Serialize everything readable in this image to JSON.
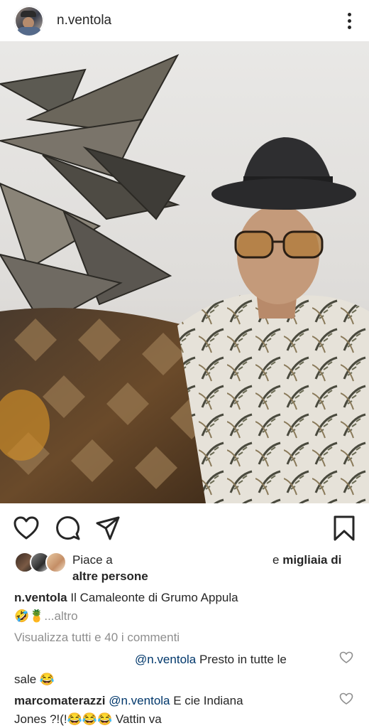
{
  "post": {
    "username": "n.ventola"
  },
  "likes": {
    "prefix": "Piace a",
    "connector": "e",
    "bold_1": "migliaia di",
    "bold_2": "altre persone"
  },
  "caption": {
    "username": "n.ventola",
    "text": "Il Camaleonte di Grumo Appula",
    "emojis": "🤣🍍",
    "more": "...altro"
  },
  "comments": {
    "view_all": "Visualizza tutti e 40 i commenti",
    "items": [
      {
        "mention": "@n.ventola",
        "text": "Presto in tutte le",
        "text_2": "sale 😂"
      },
      {
        "username": "marcomaterazzi",
        "mention": "@n.ventola",
        "text": "E cie Indiana",
        "text_2": "Jones ?!(!😂😂😂 Vattin va"
      }
    ]
  },
  "icons": {
    "like": "heart-icon",
    "comment": "comment-icon",
    "share": "paper-plane-icon",
    "save": "bookmark-icon",
    "more": "more-vertical-icon"
  }
}
